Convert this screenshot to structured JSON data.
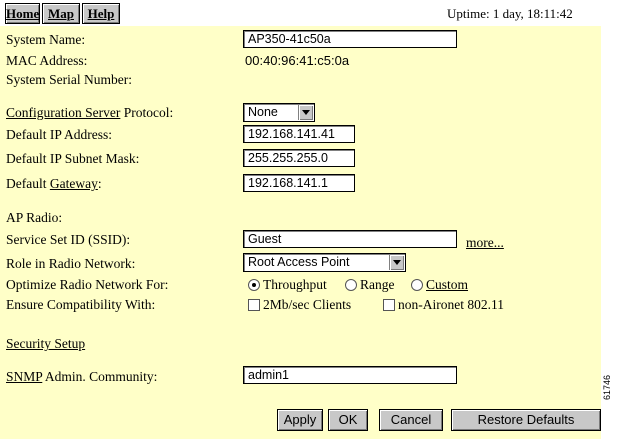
{
  "nav": {
    "home": "Home",
    "map": "Map",
    "help": "Help"
  },
  "uptime": "Uptime: 1 day, 18:11:42",
  "system": {
    "name_label": "System Name:",
    "name_value": "AP350-41c50a",
    "mac_label": "MAC Address:",
    "mac_value": "00:40:96:41:c5:0a",
    "serial_label": "System Serial Number:"
  },
  "network": {
    "config_server_link": "Configuration Server",
    "protocol_label": " Protocol:",
    "protocol_value": "None",
    "ip_label": "Default IP Address:",
    "ip_value": "192.168.141.41",
    "mask_label": "Default IP Subnet Mask:",
    "mask_value": "255.255.255.0",
    "gateway_prefix": "Default ",
    "gateway_link": "Gateway",
    "gateway_suffix": ":",
    "gateway_value": "192.168.141.1"
  },
  "radio": {
    "heading": "AP Radio:",
    "ssid_label": "Service Set ID (SSID):",
    "ssid_value": "Guest",
    "more_link": "more...",
    "role_label": "Role in Radio Network:",
    "role_value": "Root Access Point",
    "optimize_label": "Optimize Radio Network For:",
    "opt_throughput": "Throughput",
    "opt_range": "Range",
    "opt_custom": "Custom",
    "compat_label": "Ensure Compatibility With:",
    "compat_2mb": "2Mb/sec Clients",
    "compat_nonaironet": "non-Aironet 802.11"
  },
  "security_link": "Security Setup",
  "snmp": {
    "link": "SNMP",
    "label_suffix": " Admin. Community:",
    "value": "admin1"
  },
  "buttons": {
    "apply": "Apply",
    "ok": "OK",
    "cancel": "Cancel",
    "restore": "Restore Defaults"
  },
  "figure_id": "61746"
}
